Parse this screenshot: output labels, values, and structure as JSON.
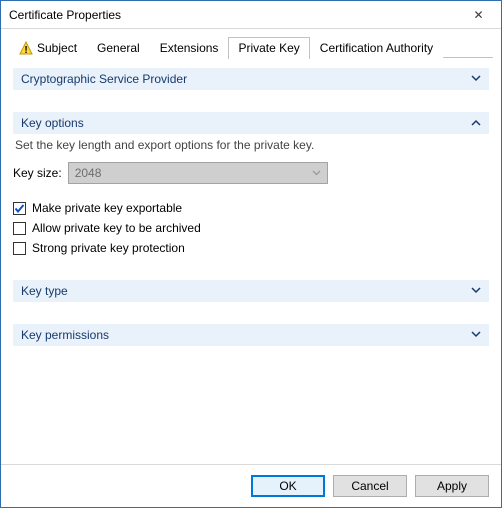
{
  "window": {
    "title": "Certificate Properties"
  },
  "tabs": {
    "subject": "Subject",
    "general": "General",
    "extensions": "Extensions",
    "private_key": "Private Key",
    "ca": "Certification Authority",
    "active": "private_key"
  },
  "sections": {
    "csp": {
      "title": "Cryptographic Service Provider"
    },
    "key_options": {
      "title": "Key options",
      "desc": "Set the key length and export options for the private key.",
      "key_size_label": "Key size:",
      "key_size_value": "2048",
      "exportable": "Make private key exportable",
      "exportable_checked": true,
      "archivable": "Allow private key to be archived",
      "archivable_checked": false,
      "strong": "Strong private key protection",
      "strong_checked": false
    },
    "key_type": {
      "title": "Key type"
    },
    "key_permissions": {
      "title": "Key permissions"
    }
  },
  "buttons": {
    "ok": "OK",
    "cancel": "Cancel",
    "apply": "Apply"
  },
  "glyphs": {
    "close": "✕",
    "chev_down": "v",
    "chev_up": "ʌ"
  }
}
